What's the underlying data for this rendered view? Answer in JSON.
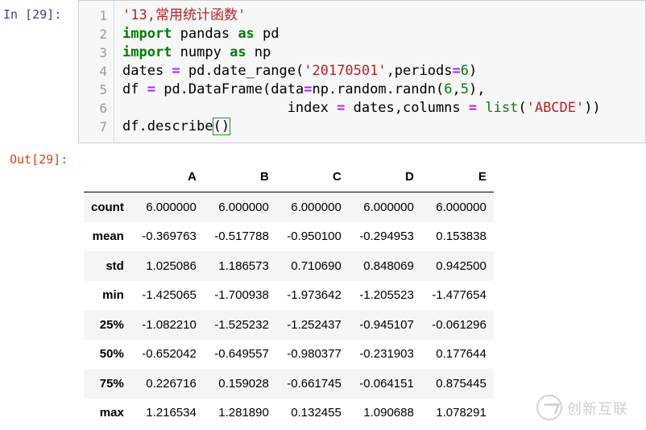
{
  "input_prompt": "In  [29]:",
  "output_prompt": "Out[29]:",
  "code": {
    "line_numbers": [
      "1",
      "2",
      "3",
      "4",
      "5",
      "6",
      "7"
    ],
    "l1": {
      "str": "'13,常用统计函数'"
    },
    "l2": {
      "kw1": "import",
      "t1": " pandas ",
      "kw2": "as",
      "t2": " pd"
    },
    "l3": {
      "kw1": "import",
      "t1": " numpy ",
      "kw2": "as",
      "t2": " np"
    },
    "l4": {
      "t1": "dates ",
      "op": "=",
      "t2": " pd.date_range(",
      "str": "'20170501'",
      "t3": ",periods",
      "op2": "=",
      "num": "6",
      "t4": ")"
    },
    "l5": {
      "t1": "df ",
      "op": "=",
      "t2": " pd.DataFrame(data",
      "op2": "=",
      "t3": "np.random.randn(",
      "num1": "6",
      "t4": ",",
      "num2": "5",
      "t5": "),"
    },
    "l6": {
      "t1": "                    index ",
      "op": "=",
      "t2": " dates,columns ",
      "op2": "=",
      "t3": " ",
      "bi": "list",
      "t4": "(",
      "str": "'ABCDE'",
      "t5": "))"
    },
    "l7": {
      "t1": "df.describe",
      "paren": "()"
    }
  },
  "table": {
    "columns": [
      "",
      "A",
      "B",
      "C",
      "D",
      "E"
    ],
    "rows": [
      {
        "label": "count",
        "values": [
          "6.000000",
          "6.000000",
          "6.000000",
          "6.000000",
          "6.000000"
        ]
      },
      {
        "label": "mean",
        "values": [
          "-0.369763",
          "-0.517788",
          "-0.950100",
          "-0.294953",
          "0.153838"
        ]
      },
      {
        "label": "std",
        "values": [
          "1.025086",
          "1.186573",
          "0.710690",
          "0.848069",
          "0.942500"
        ]
      },
      {
        "label": "min",
        "values": [
          "-1.425065",
          "-1.700938",
          "-1.973642",
          "-1.205523",
          "-1.477654"
        ]
      },
      {
        "label": "25%",
        "values": [
          "-1.082210",
          "-1.525232",
          "-1.252437",
          "-0.945107",
          "-0.061296"
        ]
      },
      {
        "label": "50%",
        "values": [
          "-0.652042",
          "-0.649557",
          "-0.980377",
          "-0.231903",
          "0.177644"
        ]
      },
      {
        "label": "75%",
        "values": [
          "0.226716",
          "0.159028",
          "-0.661745",
          "-0.064151",
          "0.875445"
        ]
      },
      {
        "label": "max",
        "values": [
          "1.216534",
          "1.281890",
          "0.132455",
          "1.090688",
          "1.078291"
        ]
      }
    ]
  },
  "watermark": {
    "text": "创新互联",
    "icon": "brand-logo-icon"
  }
}
